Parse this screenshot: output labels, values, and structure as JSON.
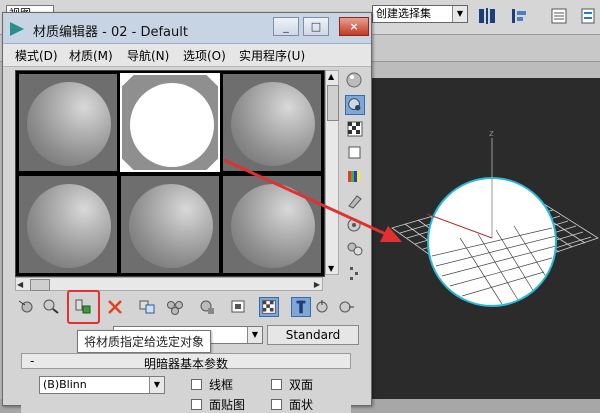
{
  "background": {
    "view_select": "视图",
    "selection_set": "创建选择集",
    "axis_label": "z"
  },
  "window": {
    "title": "材质编辑器 - 02 - Default",
    "controls": {
      "minimize": "_",
      "maximize": "□",
      "close": "×"
    }
  },
  "menu": [
    "模式(D)",
    "材质(M)",
    "导航(N)",
    "选项(O)",
    "实用程序(U)"
  ],
  "sample_slots": {
    "count": 6,
    "active_index": 1
  },
  "bottom_toolbar": {
    "tooltip": "将材质指定给选定对象",
    "highlighted_tool": "assign-material-to-selection-icon"
  },
  "material": {
    "name": "",
    "type": "Standard"
  },
  "rollout": {
    "toggle": "-",
    "title": "明暗器基本参数",
    "shader": "(B)Blinn",
    "options": [
      "线框",
      "双面",
      "面贴图",
      "面状"
    ]
  },
  "colors": {
    "annotation_red": "#e03030",
    "highlight_blue": "#7ea7d8",
    "viewport_sphere_edge": "#2ab7d9"
  }
}
